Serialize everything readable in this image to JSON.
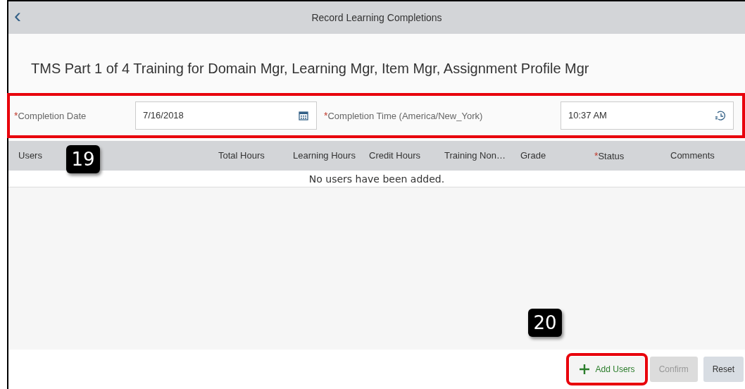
{
  "header": {
    "back": "‹",
    "title": "Record Learning Completions"
  },
  "course_title": "TMS Part 1 of 4 Training for Domain Mgr, Learning Mgr, Item Mgr, Assignment Profile Mgr",
  "fields_highlighted": true,
  "fields": [
    {
      "required_mark": "*",
      "label": "Completion Date",
      "value": "7/16/2018",
      "kind": "date"
    },
    {
      "required_mark": "*",
      "label": "Completion Time (America/New_York)",
      "value": "10:37 AM",
      "kind": "time"
    }
  ],
  "table": {
    "columns": [
      {
        "label": "Users"
      },
      {
        "label": "Total Hours"
      },
      {
        "label": "Learning Hours"
      },
      {
        "label": "Credit Hours"
      },
      {
        "label": "Training Non…"
      },
      {
        "label": "Grade"
      },
      {
        "required_mark": "*",
        "label": "Status"
      },
      {
        "label": "Comments"
      }
    ],
    "empty_message": "No users have been added."
  },
  "buttons": [
    {
      "label": "Add Users",
      "kind": "add",
      "disabled": false,
      "highlighted": true
    },
    {
      "label": "Confirm",
      "kind": "plain",
      "disabled": true,
      "highlighted": false
    },
    {
      "label": "Reset",
      "kind": "plain",
      "disabled": false,
      "highlighted": false
    }
  ],
  "callouts": [
    "19",
    "20"
  ]
}
